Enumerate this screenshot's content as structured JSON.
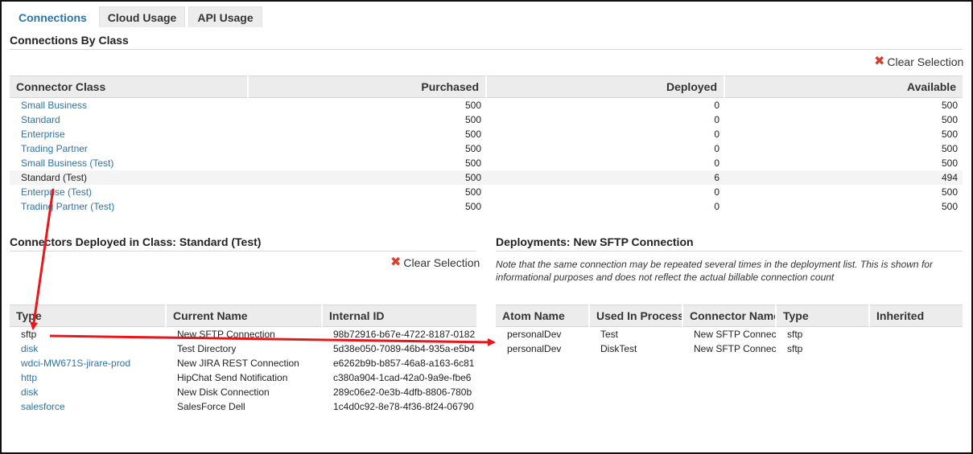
{
  "tabs": [
    {
      "label": "Connections",
      "active": true
    },
    {
      "label": "Cloud Usage",
      "active": false
    },
    {
      "label": "API Usage",
      "active": false
    }
  ],
  "class_section": {
    "title": "Connections By Class",
    "clear_label": "Clear Selection",
    "headers": [
      "Connector Class",
      "Purchased",
      "Deployed",
      "Available"
    ],
    "rows": [
      {
        "name": "Small Business",
        "purchased": "500",
        "deployed": "0",
        "available": "500",
        "link": true
      },
      {
        "name": "Standard",
        "purchased": "500",
        "deployed": "0",
        "available": "500",
        "link": true
      },
      {
        "name": "Enterprise",
        "purchased": "500",
        "deployed": "0",
        "available": "500",
        "link": true
      },
      {
        "name": "Trading Partner",
        "purchased": "500",
        "deployed": "0",
        "available": "500",
        "link": true
      },
      {
        "name": "Small Business (Test)",
        "purchased": "500",
        "deployed": "0",
        "available": "500",
        "link": true
      },
      {
        "name": "Standard (Test)",
        "purchased": "500",
        "deployed": "6",
        "available": "494",
        "link": false
      },
      {
        "name": "Enterprise (Test)",
        "purchased": "500",
        "deployed": "0",
        "available": "500",
        "link": true
      },
      {
        "name": "Trading Partner (Test)",
        "purchased": "500",
        "deployed": "0",
        "available": "500",
        "link": true
      }
    ]
  },
  "deployed_section": {
    "title": "Connectors Deployed in Class: Standard (Test)",
    "clear_label": "Clear Selection",
    "headers": [
      "Type",
      "Current Name",
      "Internal ID"
    ],
    "rows": [
      {
        "type": "sftp",
        "name": "New SFTP Connection",
        "id": "98b72916-b67e-4722-8187-0182",
        "link": false
      },
      {
        "type": "disk",
        "name": "Test Directory",
        "id": "5d38e050-7089-46b4-935a-e5b4",
        "link": true
      },
      {
        "type": "wdci-MW671S-jirare-prod",
        "name": "New JIRA REST Connection",
        "id": "e6262b9b-b857-46a8-a163-6c81",
        "link": true
      },
      {
        "type": "http",
        "name": "HipChat Send Notification",
        "id": "c380a904-1cad-42a0-9a9e-fbe6",
        "link": true
      },
      {
        "type": "disk",
        "name": "New Disk Connection",
        "id": "289c06e2-0e3b-4dfb-8806-780b",
        "link": true
      },
      {
        "type": "salesforce",
        "name": "SalesForce Dell",
        "id": "1c4d0c92-8e78-4f36-8f24-06790",
        "link": true
      }
    ]
  },
  "deployments_section": {
    "title": "Deployments: New SFTP Connection",
    "note": "Note that the same connection may be repeated several times in the deployment list. This is shown for informational purposes and does not reflect the actual billable connection count",
    "headers": [
      "Atom Name",
      "Used In Process",
      "Connector Name",
      "Type",
      "Inherited"
    ],
    "rows": [
      {
        "atom": "personalDev",
        "process": "Test",
        "connector": "New SFTP Connection",
        "type": "sftp",
        "inherited": ""
      },
      {
        "atom": "personalDev",
        "process": "DiskTest",
        "connector": "New SFTP Connection",
        "type": "sftp",
        "inherited": ""
      }
    ]
  },
  "colors": {
    "accent": "#2d73a6",
    "arrow": "#e8171b",
    "header_bg": "#ececec",
    "alt_row": "#f4f4f4",
    "clear_icon": "#d4412b"
  }
}
